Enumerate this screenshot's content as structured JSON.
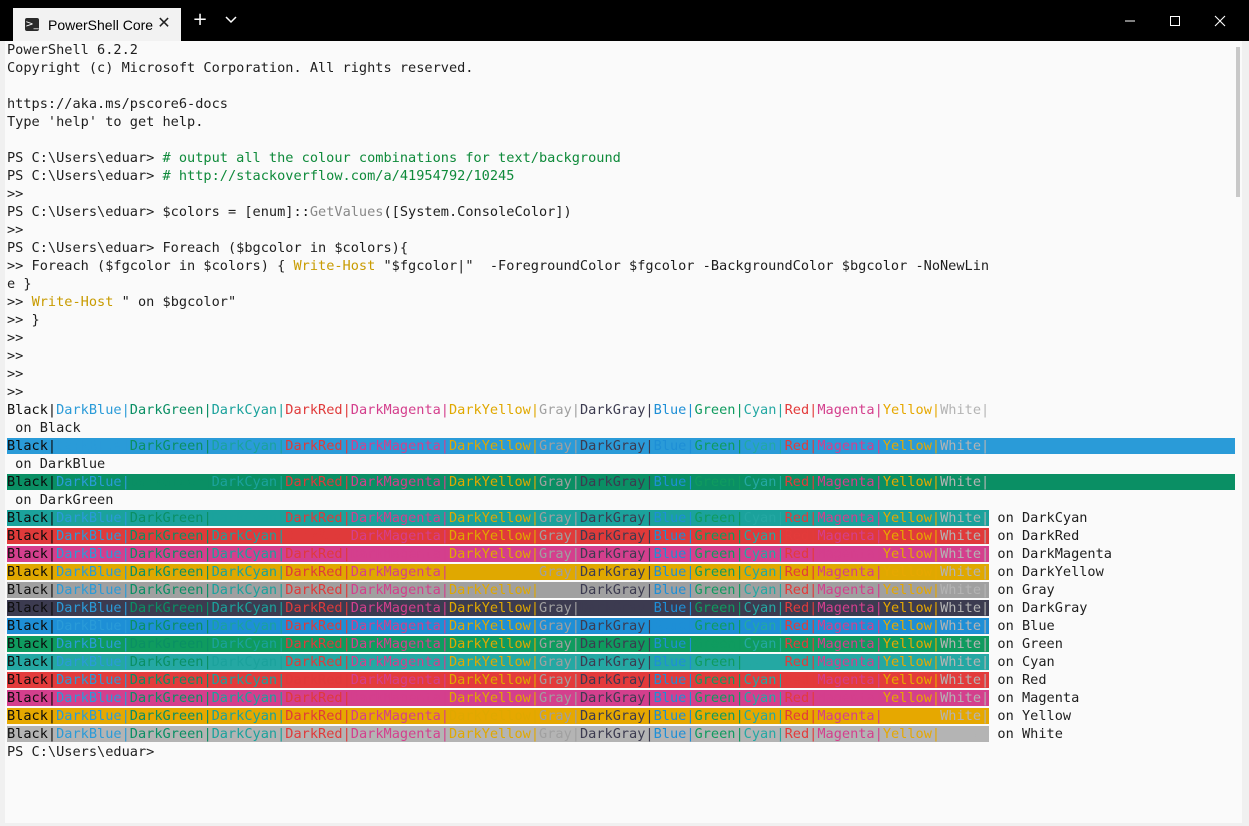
{
  "window": {
    "tab_title": "PowerShell Core",
    "tab_icon_glyph": ">_",
    "new_tab_glyph": "+",
    "dropdown_glyph": "⌄",
    "minimize_glyph": "—",
    "maximize_glyph": "□",
    "close_glyph": "✕",
    "tab_close_glyph": "✕"
  },
  "colors": {
    "Black": "#0c0c0c",
    "DarkBlue": "#2a9bd8",
    "DarkGreen": "#0a8f64",
    "DarkCyan": "#1ba29c",
    "DarkRed": "#e03a3a",
    "DarkMagenta": "#d43f8d",
    "DarkYellow": "#e0a800",
    "Gray": "#a0a0a0",
    "DarkGray": "#3c3b50",
    "Blue": "#1e8fd6",
    "Green": "#0f9b5f",
    "Cyan": "#24a8a3",
    "Red": "#e33b3b",
    "Magenta": "#d43f8d",
    "Yellow": "#e6a800",
    "White": "#b4b4b4"
  },
  "terminal": {
    "lines": [
      "PowerShell 6.2.2",
      "Copyright (c) Microsoft Corporation. All rights reserved.",
      "",
      "https://aka.ms/pscore6-docs",
      "Type 'help' to get help.",
      "",
      "PS C:\\Users\\eduar> # output all the colour combinations for text/background",
      "PS C:\\Users\\eduar> # http://stackoverflow.com/a/41954792/10245",
      ">>",
      "PS C:\\Users\\eduar> $colors = [enum]::GetValues([System.ConsoleColor])",
      ">>",
      "PS C:\\Users\\eduar> Foreach ($bgcolor in $colors){",
      ">> Foreach ($fgcolor in $colors) { Write-Host \"$fgcolor|\"  -ForegroundColor $fgcolor -BackgroundColor $bgcolor -NoNewLin",
      "e }",
      ">> Write-Host \" on $bgcolor\"",
      ">> }",
      ">>",
      ">>",
      ">>",
      ">>"
    ],
    "color_names": [
      "Black",
      "DarkBlue",
      "DarkGreen",
      "DarkCyan",
      "DarkRed",
      "DarkMagenta",
      "DarkYellow",
      "Gray",
      "DarkGray",
      "Blue",
      "Green",
      "Cyan",
      "Red",
      "Magenta",
      "Yellow",
      "White"
    ],
    "on_prefix": " on ",
    "final_prompt": "PS C:\\Users\\eduar>"
  }
}
